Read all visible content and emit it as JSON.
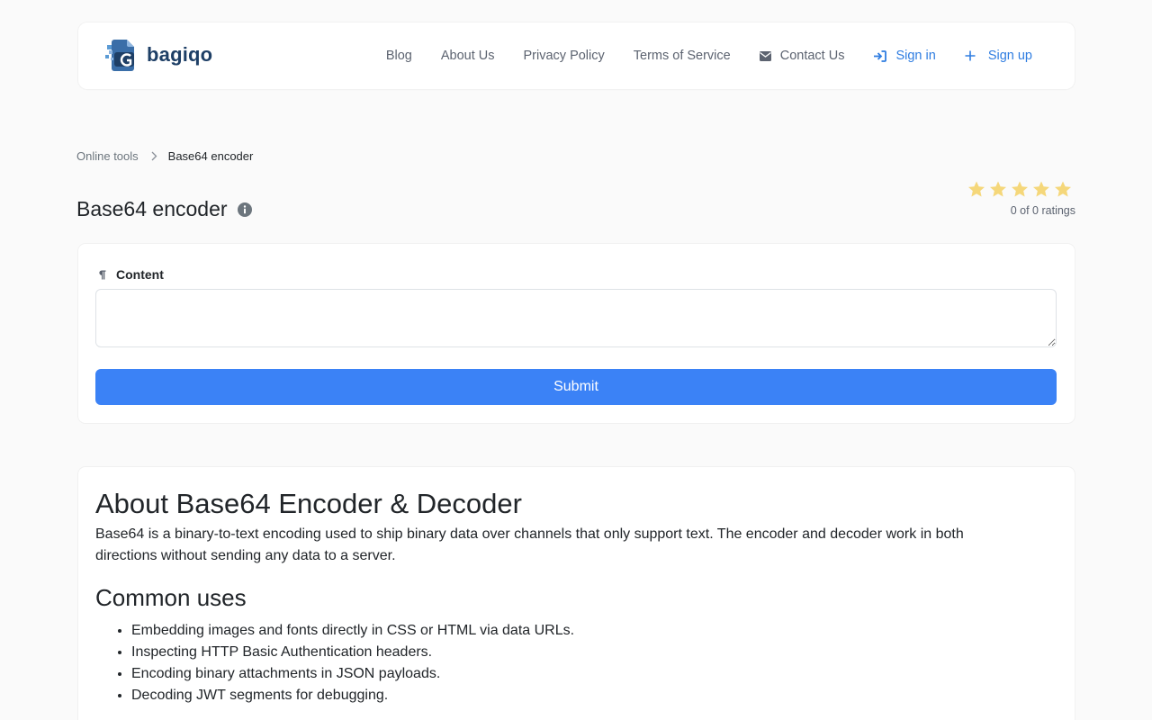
{
  "brand": {
    "name": "bagiqo"
  },
  "nav": {
    "blog": "Blog",
    "about": "About Us",
    "privacy": "Privacy Policy",
    "terms": "Terms of Service",
    "contact": "Contact Us",
    "sign_in": "Sign in",
    "sign_up": "Sign up"
  },
  "breadcrumb": {
    "parent": "Online tools",
    "current": "Base64 encoder"
  },
  "page": {
    "title": "Base64 encoder"
  },
  "rating": {
    "text": "0 of 0 ratings",
    "value": 0,
    "max": 5
  },
  "form": {
    "content_label": "Content",
    "content_value": "",
    "submit_label": "Submit"
  },
  "about": {
    "title": "About Base64 Encoder & Decoder",
    "text": "Base64 is a binary-to-text encoding used to ship binary data over channels that only support text. The encoder and decoder work in both directions without sending any data to a server.",
    "uses_title": "Common uses",
    "uses": [
      "Embedding images and fonts directly in CSS or HTML via data URLs.",
      "Inspecting HTTP Basic Authentication headers.",
      "Encoding binary attachments in JSON payloads.",
      "Decoding JWT segments for debugging."
    ]
  },
  "colors": {
    "accent": "#2f7de1",
    "button": "#3b82f6",
    "star": "#f5d77a",
    "brand_dark": "#1e3f66"
  },
  "icons": {
    "logo": "bagiqo-logo-icon",
    "contact": "envelope-icon",
    "sign_in": "sign-in-arrow-icon",
    "sign_up": "plus-icon",
    "breadcrumb_separator": "chevron-right-icon",
    "info": "info-circle-icon",
    "rating": "star-icon",
    "content_label": "pilcrow-icon"
  }
}
